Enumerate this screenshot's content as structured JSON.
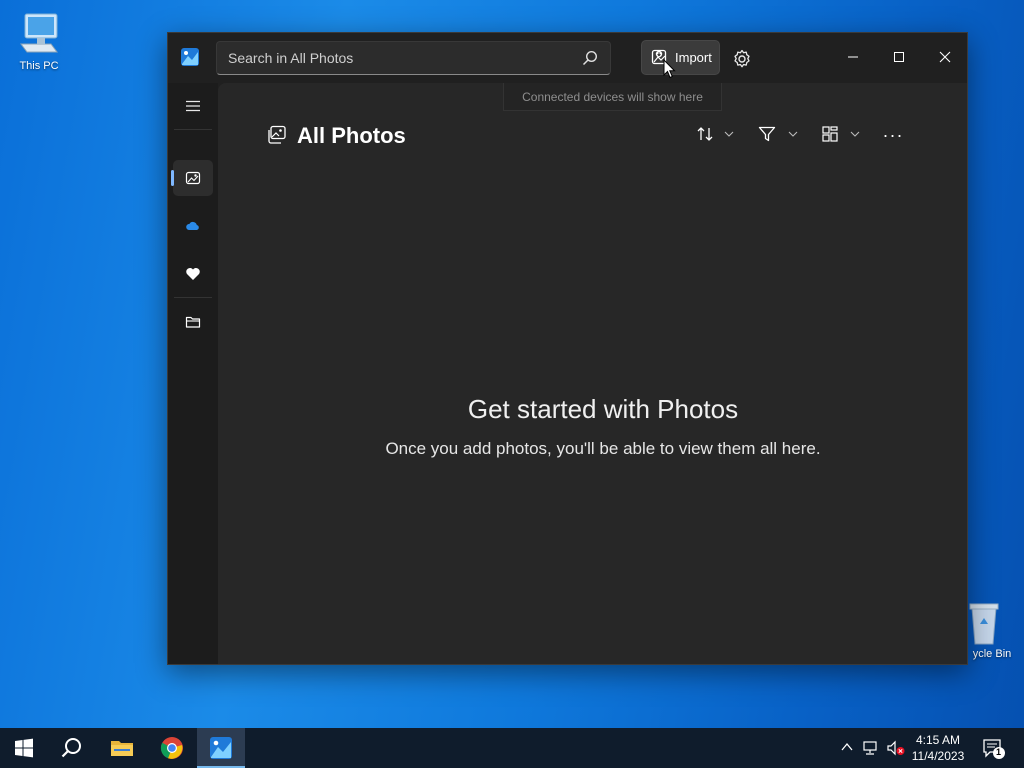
{
  "desktop": {
    "icons": [
      {
        "label": "This PC"
      },
      {
        "label": "ycle Bin"
      }
    ]
  },
  "window": {
    "search": {
      "placeholder": "Search in All Photos"
    },
    "import_label": "Import",
    "tooltip": "Connected devices will show here",
    "title": "All Photos",
    "empty_title": "Get started with Photos",
    "empty_subtitle": "Once you add photos, you'll be able to view them all here.",
    "more_label": "..."
  },
  "taskbar": {
    "time": "4:15 AM",
    "date": "11/4/2023",
    "notification_count": "1"
  },
  "colors": {
    "window_bg": "#202020",
    "main_bg": "#272727",
    "accent": "#7fb8ff",
    "taskbar": "#0f1c2c"
  }
}
